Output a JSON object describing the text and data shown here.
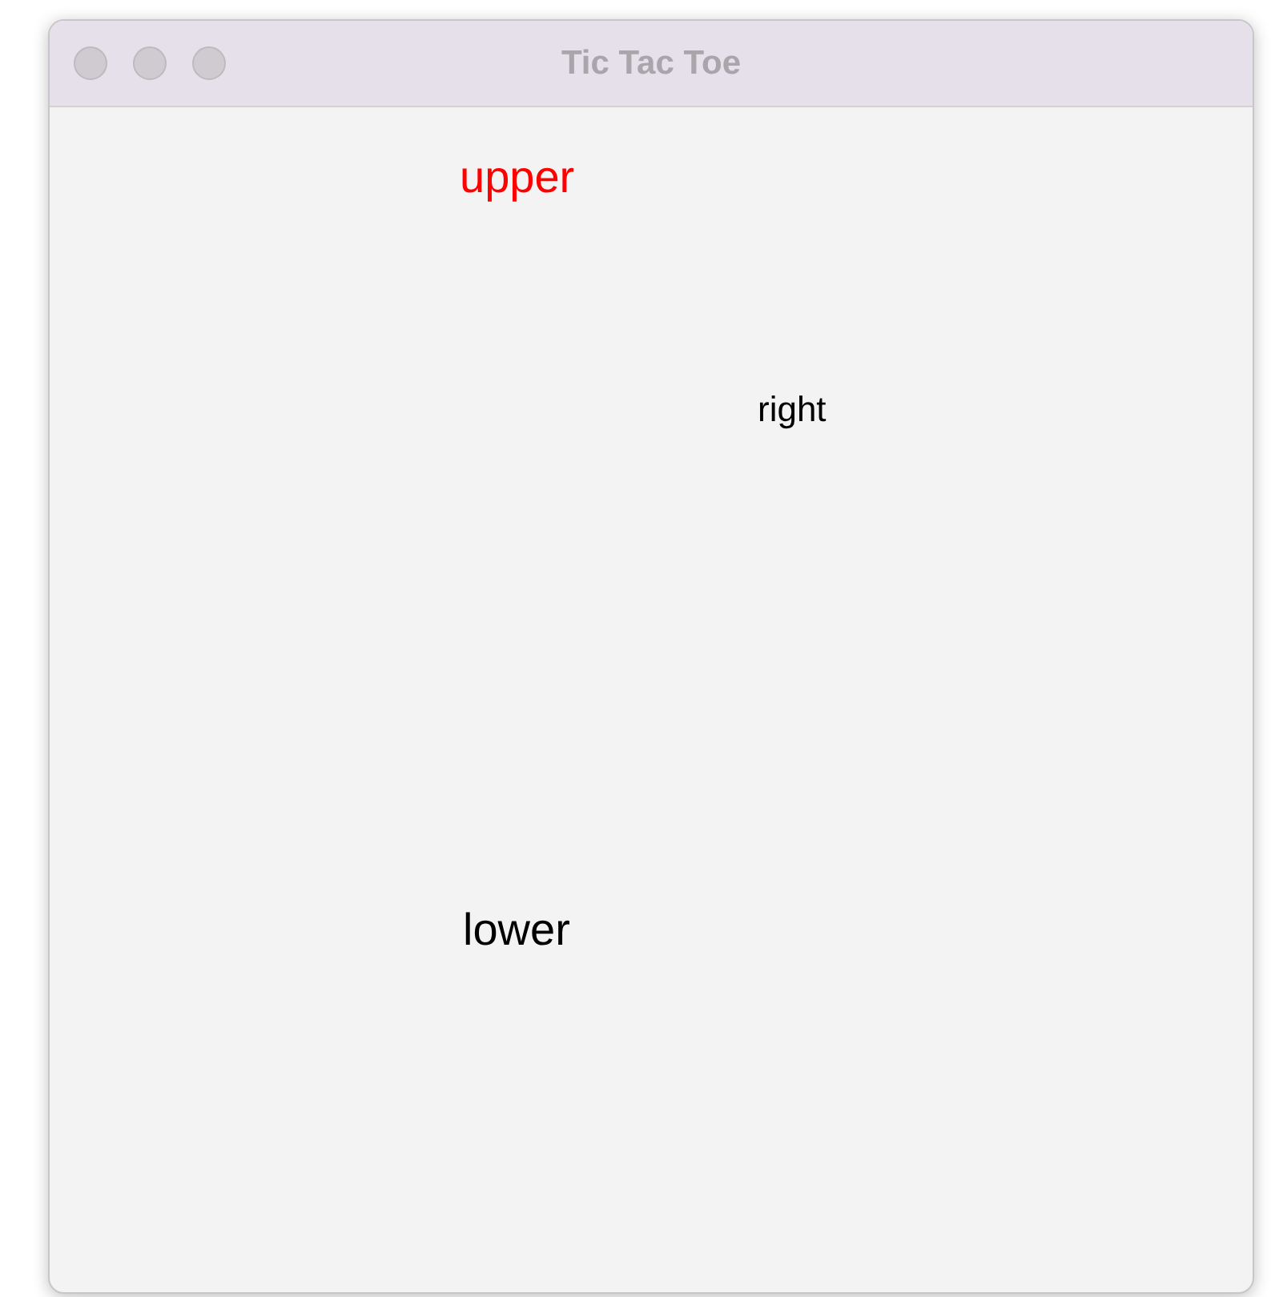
{
  "window": {
    "title": "Tic Tac Toe"
  },
  "labels": [
    {
      "text": "upper",
      "color": "#ff0000"
    },
    {
      "text": "right",
      "color": "#000000"
    },
    {
      "text": "lower",
      "color": "#000000"
    }
  ]
}
